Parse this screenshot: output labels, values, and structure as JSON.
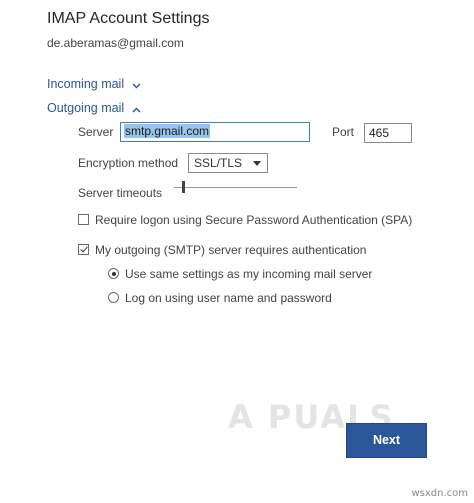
{
  "dialog": {
    "title": "IMAP Account Settings",
    "email": "de.aberamas@gmail.com"
  },
  "incoming": {
    "label": "Incoming mail",
    "icon": "chevron-down-icon"
  },
  "outgoing": {
    "label": "Outgoing mail",
    "icon": "chevron-up-icon",
    "server_label": "Server",
    "server_value": "smtp.gmail.com",
    "port_label": "Port",
    "port_value": "465",
    "encryption_label": "Encryption method",
    "encryption_value": "SSL/TLS",
    "timeouts_label": "Server timeouts",
    "timeout_level": 0.08,
    "spa_label": "Require logon using Secure Password Authentication (SPA)",
    "spa_checked": false,
    "smtp_auth_label": "My outgoing (SMTP) server requires authentication",
    "smtp_auth_checked": true,
    "radio_same_label": "Use same settings as my incoming mail server",
    "radio_same_selected": true,
    "radio_logon_label": "Log on using user name and password",
    "radio_logon_selected": false
  },
  "actions": {
    "next_label": "Next"
  },
  "watermark": {
    "logo": "A PUALS",
    "site": "wsxdn.com"
  },
  "colors": {
    "accent": "#2b579a",
    "selection": "#99c4ea"
  }
}
